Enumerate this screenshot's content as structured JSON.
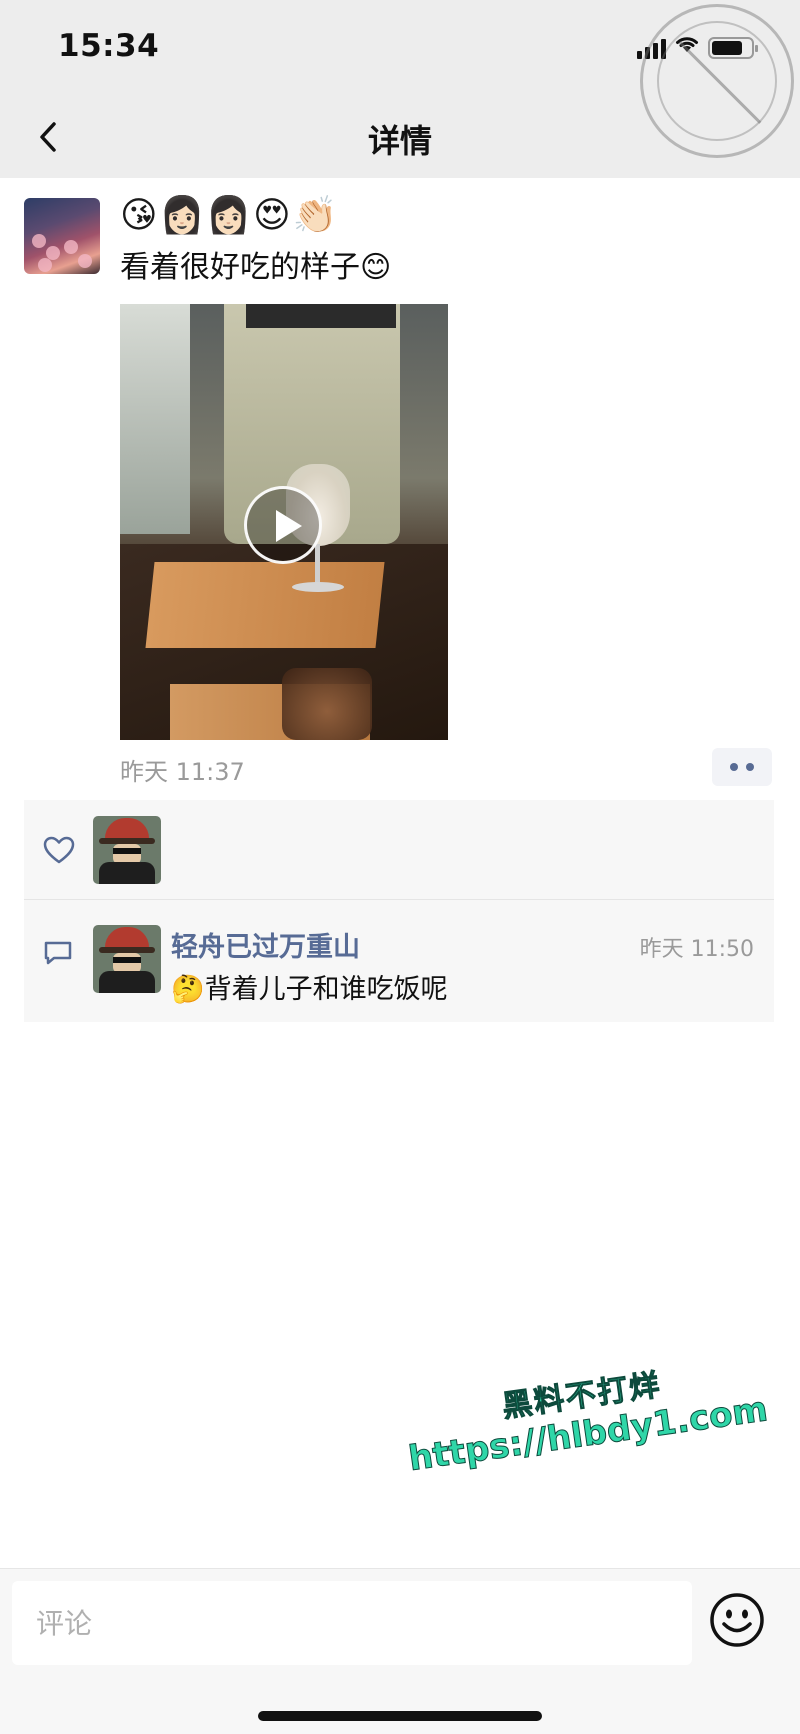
{
  "status_bar": {
    "time": "15:34"
  },
  "nav": {
    "title": "详情"
  },
  "post": {
    "emojis": "😘👩🏻👩🏻😍👏🏻",
    "text": "看着很好吃的样子😊",
    "time": "昨天 11:37"
  },
  "likes": {
    "count": 1
  },
  "comment": {
    "author": "轻舟已过万重山",
    "time": "昨天 11:50",
    "text": "🤔背着儿子和谁吃饭呢"
  },
  "watermark": {
    "line1": "黑料不打烊",
    "line2": "https://hlbdy1.com"
  },
  "input": {
    "placeholder": "评论"
  },
  "colors": {
    "nav_bg": "#ededed",
    "link_blue": "#576b95",
    "watermark_green": "#2fd6a8"
  }
}
